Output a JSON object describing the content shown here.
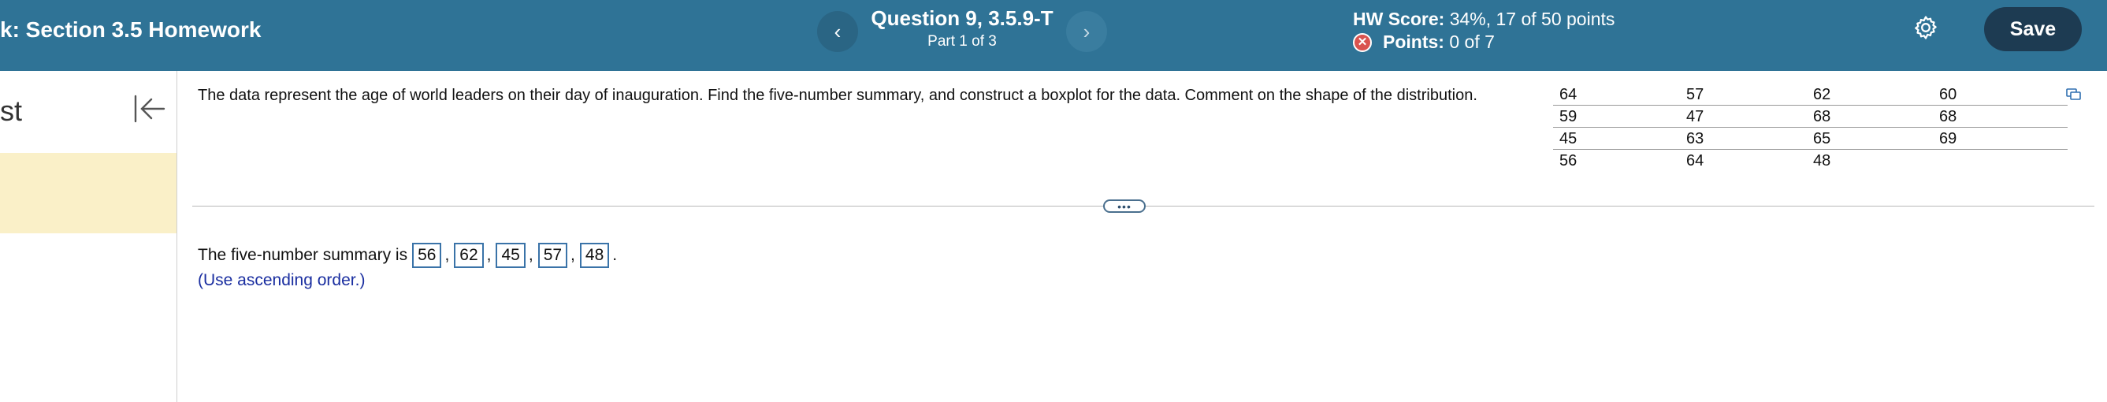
{
  "header": {
    "title": "k:  Section 3.5 Homework",
    "question_title": "Question 9, 3.5.9-T",
    "question_part": "Part 1 of 3",
    "prev_icon": "‹",
    "next_icon": "›",
    "hw_score_label": "HW Score:",
    "hw_score_value": "34%, 17 of 50 points",
    "points_label": "Points:",
    "points_value": "0 of 7",
    "save_label": "Save",
    "icons": [
      "chevron-left-icon",
      "chevron-right-icon",
      "x-circle-icon",
      "gear-icon"
    ]
  },
  "left_panel": {
    "title": "st",
    "icons": [
      "collapse-left-icon"
    ]
  },
  "question": {
    "text": "The data represent the age of world leaders on their day of inauguration. Find the five-number summary, and construct a boxplot for the data. Comment on the shape of the distribution.",
    "table": [
      [
        "64",
        "57",
        "62",
        "60"
      ],
      [
        "59",
        "47",
        "68",
        "68"
      ],
      [
        "45",
        "63",
        "65",
        "69"
      ],
      [
        "56",
        "64",
        "48",
        ""
      ]
    ]
  },
  "answer": {
    "prefix": "The five-number summary is",
    "values": [
      "56",
      "62",
      "45",
      "57",
      "48"
    ],
    "separator": ",",
    "suffix": ".",
    "hint": "(Use ascending order.)"
  },
  "divider": {
    "handle_label": "•••"
  },
  "colors": {
    "header_bg": "#2f7396",
    "save_bg": "#1d3b52",
    "highlight": "#faf0c8",
    "hint_text": "#1a2ea0"
  }
}
